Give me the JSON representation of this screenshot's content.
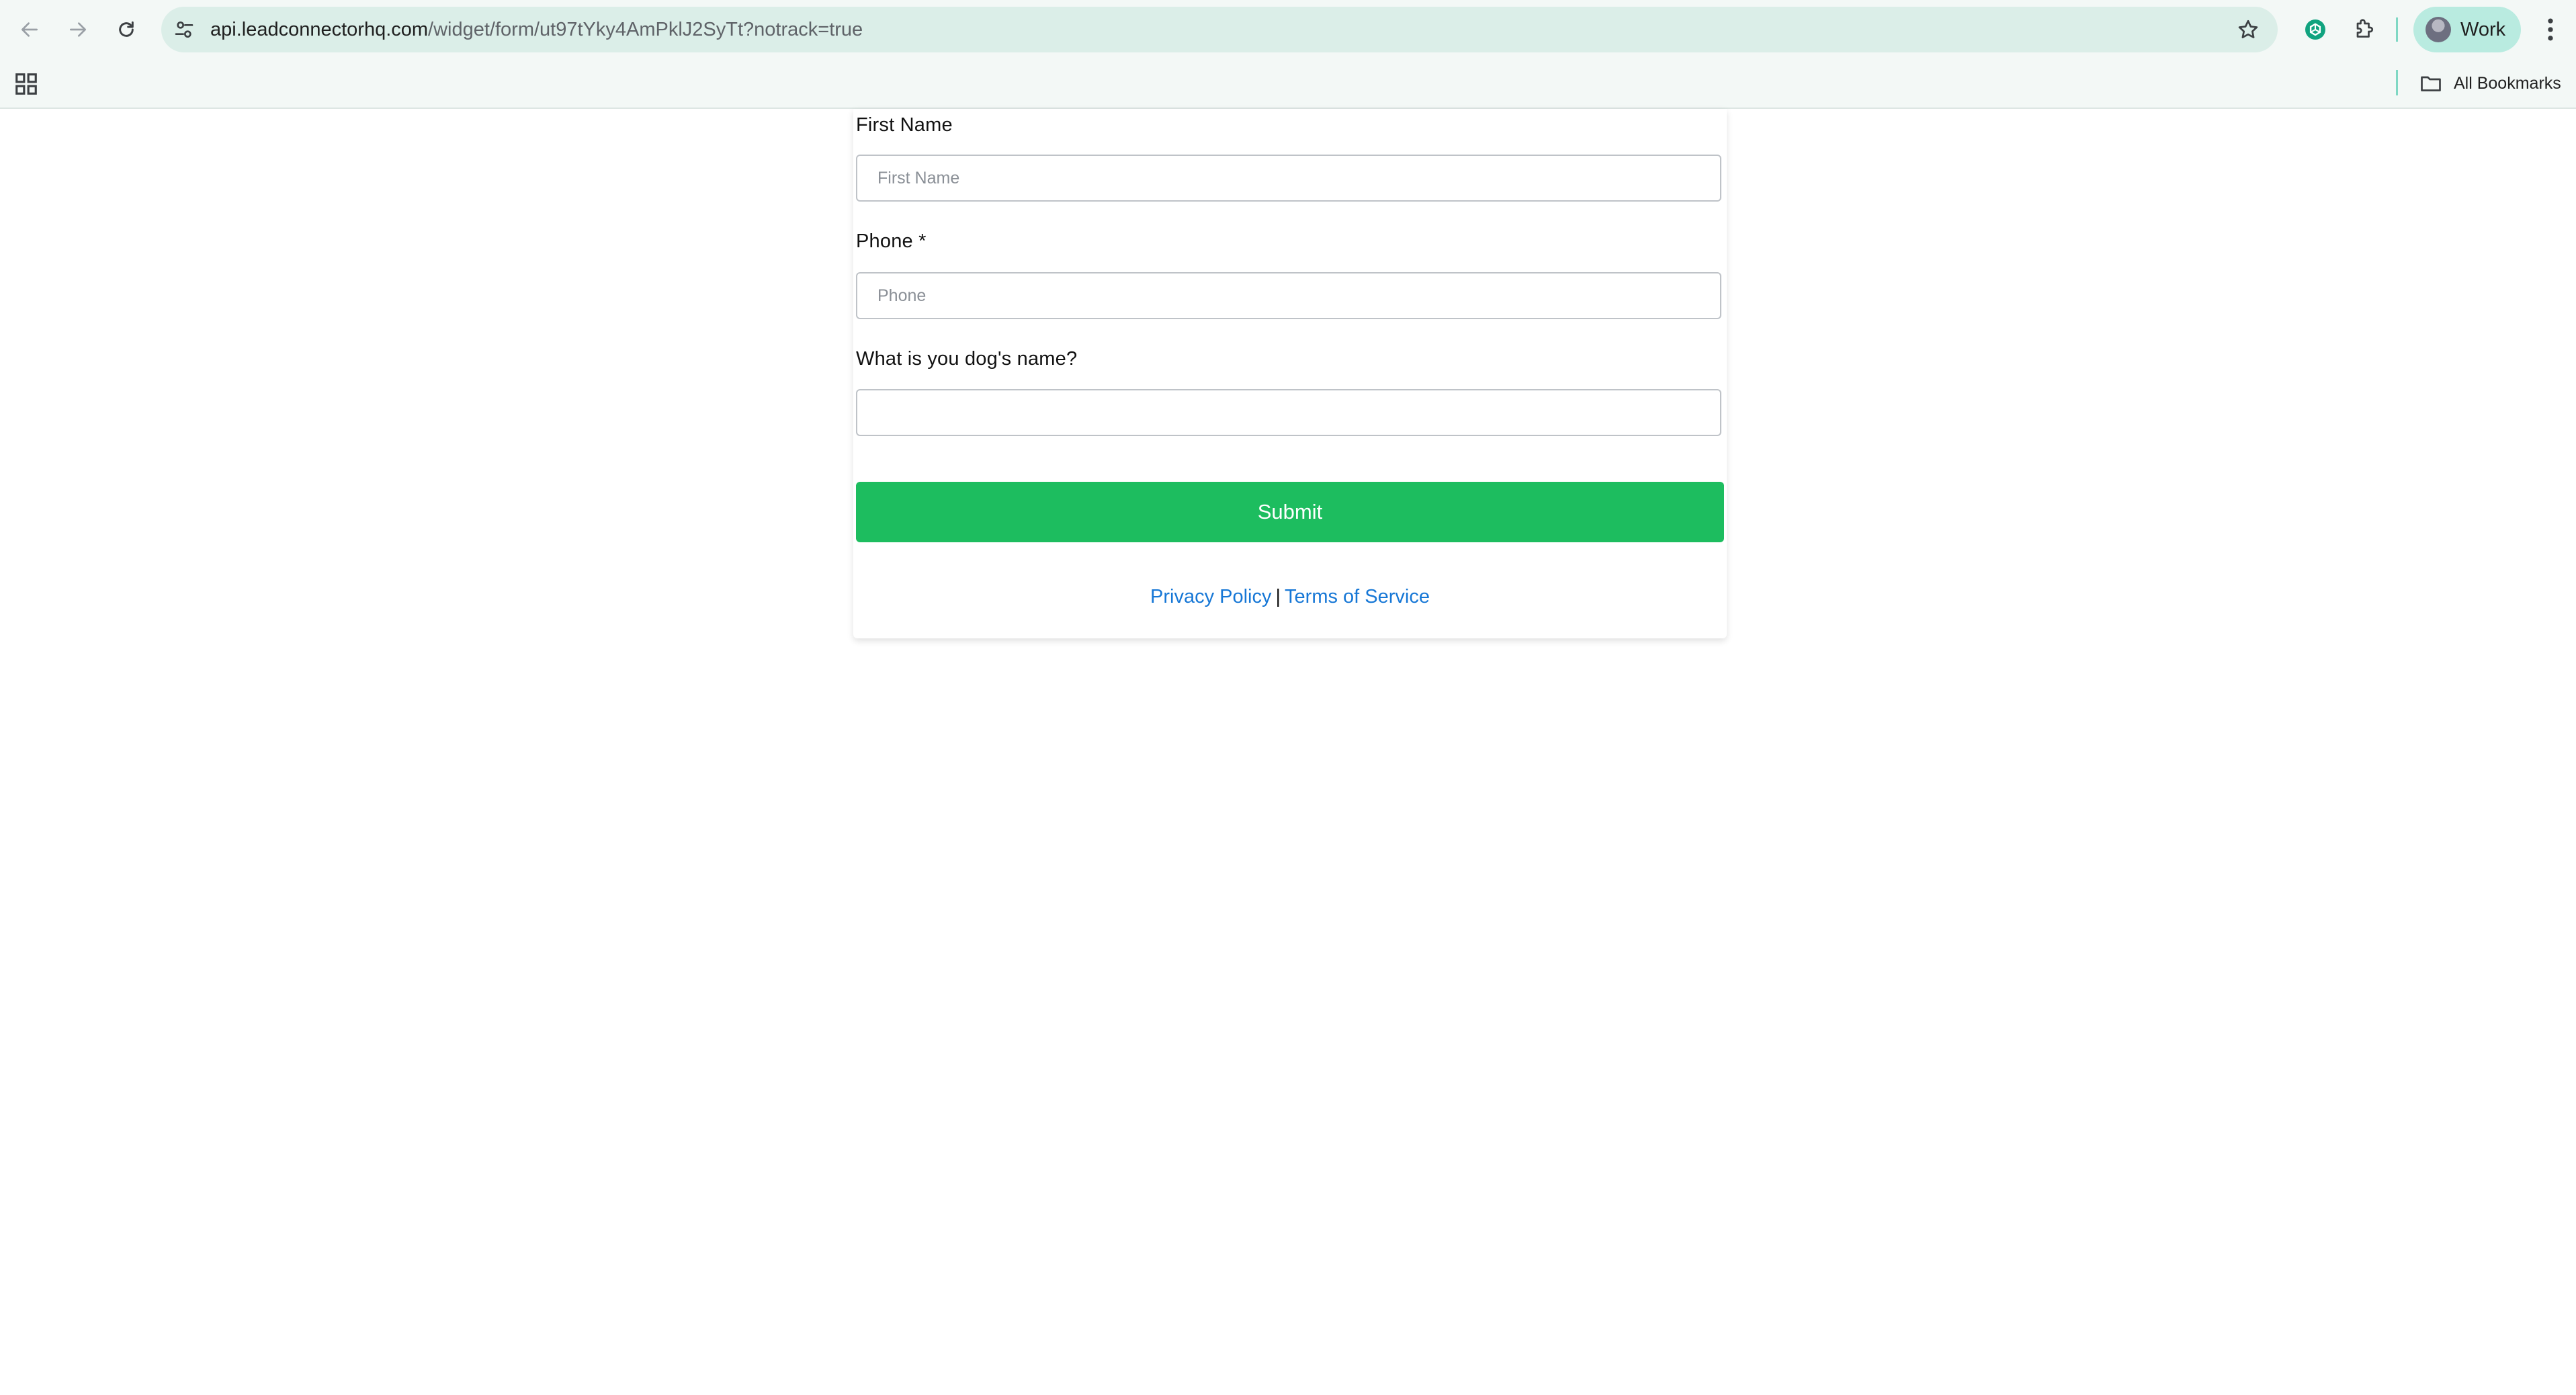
{
  "browser": {
    "url_host": "api.leadconnectorhq.com",
    "url_path": "/widget/form/ut97tYky4AmPklJ2SyTt?notrack=true",
    "profile_label": "Work",
    "bookmarks_label": "All Bookmarks",
    "icons": {
      "back": "arrow-left-icon",
      "forward": "arrow-right-icon",
      "reload": "reload-icon",
      "site_info": "tune-icon",
      "bookmark_star": "star-icon",
      "extension_1": "openai-icon",
      "extensions": "puzzle-icon",
      "menu": "more-vertical-icon",
      "apps": "apps-grid-icon",
      "bookmarks_folder": "folder-icon"
    }
  },
  "form": {
    "fields": [
      {
        "label": "First Name",
        "placeholder": "First Name",
        "value": ""
      },
      {
        "label": "Phone *",
        "placeholder": "Phone",
        "value": ""
      },
      {
        "label": "What is you dog's name?",
        "placeholder": "",
        "value": ""
      }
    ],
    "submit_label": "Submit",
    "footer": {
      "privacy": "Privacy Policy",
      "separator": "|",
      "terms": "Terms of Service"
    }
  },
  "colors": {
    "submit_bg": "#1dbd5f",
    "link": "#1677d6",
    "omnibox_bg": "#dbeee8",
    "profile_chip_bg": "#b9ebe0"
  }
}
